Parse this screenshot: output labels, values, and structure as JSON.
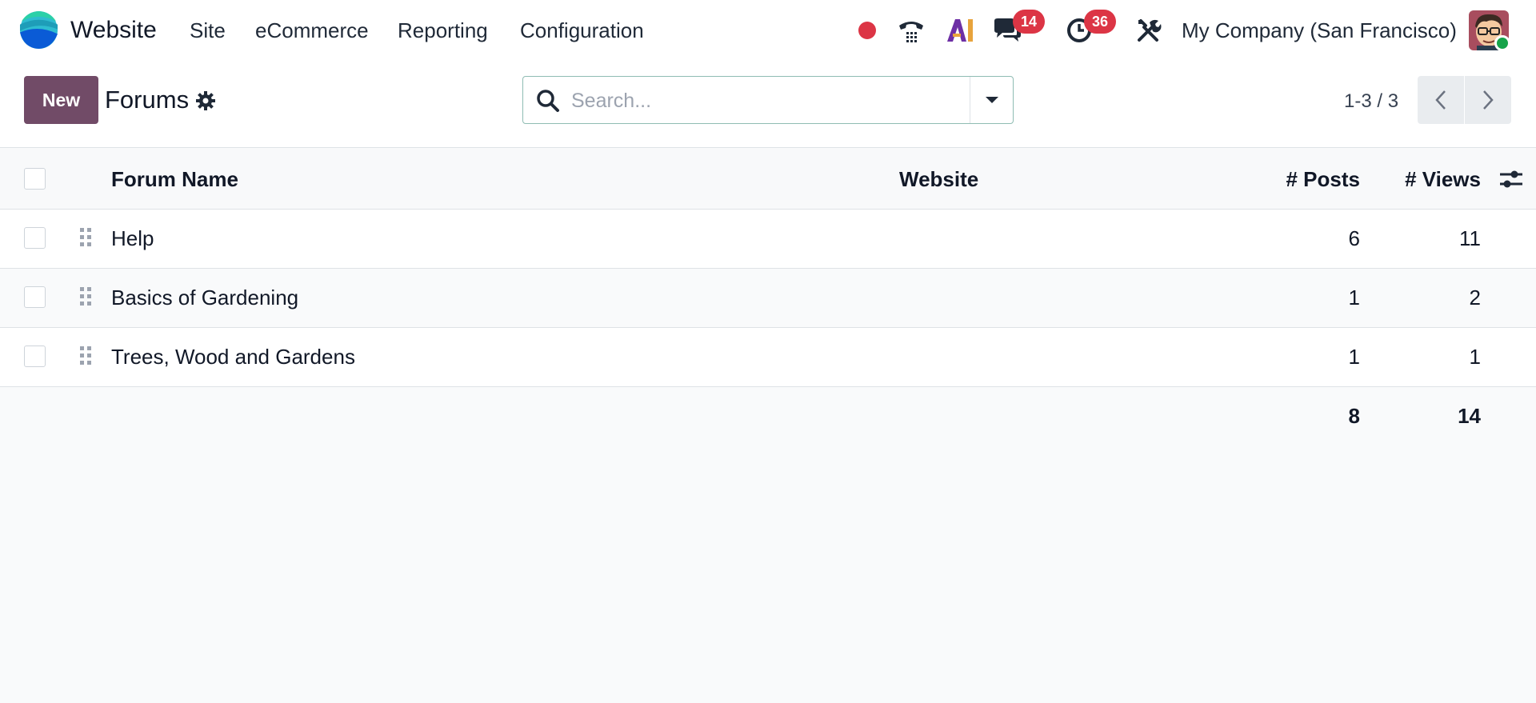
{
  "navbar": {
    "app_name": "Website",
    "menu": [
      "Site",
      "eCommerce",
      "Reporting",
      "Configuration"
    ],
    "messages_count": "14",
    "activities_count": "36",
    "company": "My Company (San Francisco)"
  },
  "control": {
    "new_label": "New",
    "breadcrumb": "Forums",
    "search_placeholder": "Search...",
    "pager": "1-3 / 3"
  },
  "list": {
    "columns": {
      "name": "Forum Name",
      "website": "Website",
      "posts": "# Posts",
      "views": "# Views"
    },
    "rows": [
      {
        "name": "Help",
        "website": "",
        "posts": "6",
        "views": "11"
      },
      {
        "name": "Basics of Gardening",
        "website": "",
        "posts": "1",
        "views": "2"
      },
      {
        "name": "Trees, Wood and Gardens",
        "website": "",
        "posts": "1",
        "views": "1"
      }
    ],
    "totals": {
      "posts": "8",
      "views": "14"
    }
  },
  "colors": {
    "primary": "#714b67",
    "badge": "#dc3545",
    "record": "#dc3545",
    "presence": "#16a34a"
  },
  "icons": [
    "app-logo",
    "record-icon",
    "phone-icon",
    "ai-icon",
    "chat-icon",
    "clock-icon",
    "tools-icon",
    "gear-icon",
    "search-icon",
    "caret-down-icon",
    "chevron-left-icon",
    "chevron-right-icon",
    "drag-handle-icon",
    "optional-columns-icon"
  ]
}
